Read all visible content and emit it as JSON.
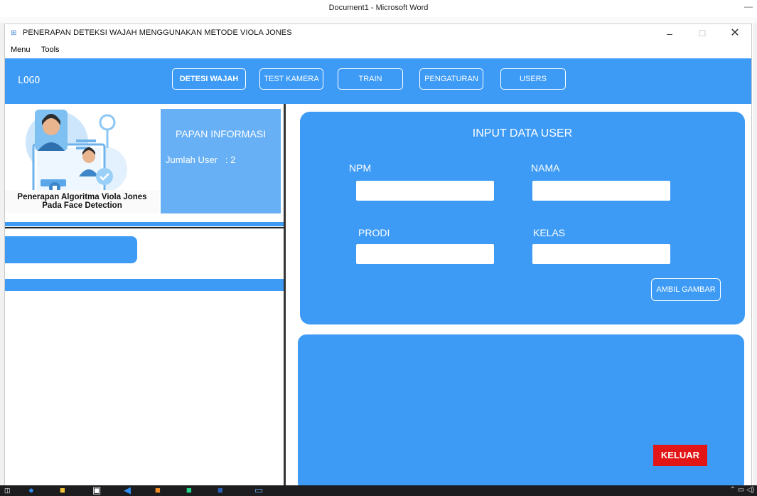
{
  "background_window": {
    "title": "Document1 - Microsoft Word"
  },
  "window": {
    "title": "PENERAPAN DETEKSI WAJAH MENGGUNAKAN METODE VIOLA JONES",
    "controls": {
      "minimize": "–",
      "maximize": "☐",
      "close": "✕"
    }
  },
  "menu": {
    "items": [
      "Menu",
      "Tools"
    ]
  },
  "navbar": {
    "logo": "LOGO",
    "buttons": [
      "DETESI WAJAH",
      "TEST KAMERA",
      "TRAIN",
      "PENGATURAN",
      "USERS"
    ],
    "active": "DETESI WAJAH"
  },
  "left": {
    "caption_line1": "Penerapan Algoritma Viola Jones",
    "caption_line2": "Pada Face Detection",
    "info_title": "PAPAN INFORMASI",
    "info_label": "Jumlah User",
    "info_sep": ":",
    "info_value": "2"
  },
  "form": {
    "title": "INPUT DATA USER",
    "npm_label": "NPM",
    "nama_label": "NAMA",
    "prodi_label": "PRODI",
    "kelas_label": "KELAS",
    "npm_value": "",
    "nama_value": "",
    "prodi_value": "",
    "kelas_value": "",
    "ambil_label": "AMBIL GAMBAR"
  },
  "keluar_label": "KELUAR",
  "colors": {
    "primary": "#3d9bf6",
    "info_panel": "#68b0f5",
    "danger": "#e21616"
  },
  "taskbar": {
    "icons": [
      "search-icon",
      "cortana-icon",
      "file-explorer-icon",
      "store-icon",
      "vscode-icon",
      "app-icon",
      "pycharm-icon",
      "word-icon",
      "python-app-icon"
    ]
  }
}
